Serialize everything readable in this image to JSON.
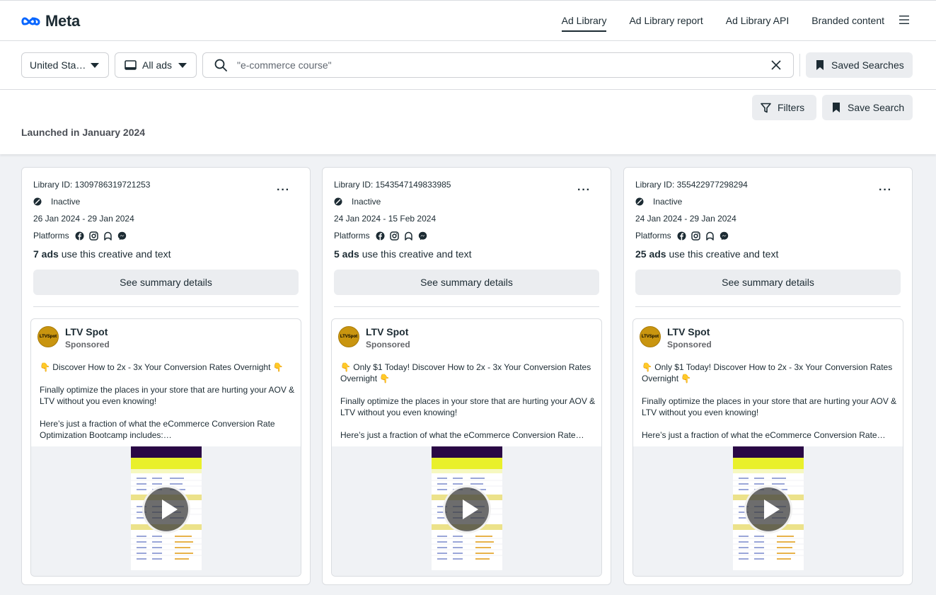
{
  "nav": {
    "logo_text": "Meta",
    "links": [
      "Ad Library",
      "Ad Library report",
      "Ad Library API",
      "Branded content"
    ]
  },
  "search": {
    "country": "United Sta…",
    "ad_type": "All ads",
    "query": "\"e-commerce course\"",
    "saved_searches": "Saved Searches"
  },
  "results": {
    "filters": "Filters",
    "save_search": "Save Search",
    "launched": "Launched in January 2024"
  },
  "colors": {
    "brand_blue": "#0866ff",
    "text": "#1c2b33",
    "button_grey": "#ebedf0"
  },
  "cards": [
    {
      "library_id": "Library ID: 1309786319721253",
      "status": "Inactive",
      "dates": "26 Jan 2024 - 29 Jan 2024",
      "platforms_label": "Platforms",
      "ads_count": "7 ads",
      "ads_suffix": " use this creative and text",
      "summary": "See summary details",
      "page_name": "LTV Spot",
      "sponsored": "Sponsored",
      "avatar_text": "LTVSpot",
      "p1": "👇 Discover How to 2x - 3x Your Conversion Rates Overnight 👇",
      "p2": "Finally optimize the places in your store that are hurting your AOV & LTV without you even knowing!",
      "p3": "Here’s just a fraction of what the eCommerce Conversion Rate Optimization Bootcamp includes:…"
    },
    {
      "library_id": "Library ID: 1543547149833985",
      "status": "Inactive",
      "dates": "24 Jan 2024 - 15 Feb 2024",
      "platforms_label": "Platforms",
      "ads_count": "5 ads",
      "ads_suffix": " use this creative and text",
      "summary": "See summary details",
      "page_name": "LTV Spot",
      "sponsored": "Sponsored",
      "avatar_text": "LTVSpot",
      "p1": "👇 Only $1 Today! Discover How to 2x - 3x Your Conversion Rates Overnight 👇",
      "p2": "Finally optimize the places in your store that are hurting your AOV & LTV without you even knowing!",
      "p3": "Here’s just a fraction of what the eCommerce Conversion Rate…"
    },
    {
      "library_id": "Library ID: 355422977298294",
      "status": "Inactive",
      "dates": "24 Jan 2024 - 29 Jan 2024",
      "platforms_label": "Platforms",
      "ads_count": "25 ads",
      "ads_suffix": " use this creative and text",
      "summary": "See summary details",
      "page_name": "LTV Spot",
      "sponsored": "Sponsored",
      "avatar_text": "LTVSpot",
      "p1": "👇 Only $1 Today! Discover How to 2x - 3x Your Conversion Rates Overnight 👇",
      "p2": "Finally optimize the places in your store that are hurting your AOV & LTV without you even knowing!",
      "p3": "Here’s just a fraction of what the eCommerce Conversion Rate…"
    }
  ]
}
